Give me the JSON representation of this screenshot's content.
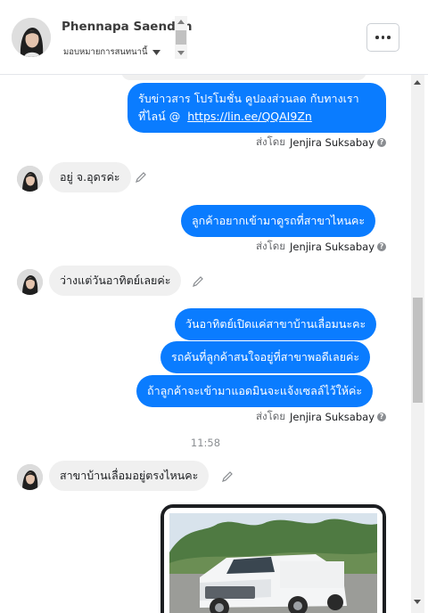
{
  "header": {
    "contact_name": "Phennapa Saendan",
    "assign_label": "มอบหมายการสนทนานี้",
    "more_label": "..."
  },
  "messages": [
    {
      "type": "outgoing",
      "lines": [
        "รับข่าวสาร  โปรโมชั่น คูปองส่วนลด กับทางเรา",
        "ที่ไลน์ @"
      ],
      "link": "https://lin.ee/QQAI9Zn"
    },
    {
      "type": "sent_by",
      "prefix": "ส่งโดย",
      "agent": "Jenjira Suksabay"
    },
    {
      "type": "incoming",
      "text": "อยู่ จ.อุดรค่ะ"
    },
    {
      "type": "outgoing",
      "text": "ลูกค้าอยากเข้ามาดูรถที่สาขาไหนคะ"
    },
    {
      "type": "sent_by",
      "prefix": "ส่งโดย",
      "agent": "Jenjira Suksabay"
    },
    {
      "type": "incoming",
      "text": "ว่างแต่วันอาทิตย์เลยค่ะ"
    },
    {
      "type": "outgoing",
      "text": "วันอาทิตย์เปิดแค่สาขาบ้านเลื่อมนะคะ"
    },
    {
      "type": "outgoing",
      "text": "รถคันที่ลูกค้าสนใจอยู่ที่สาขาพอดีเลยค่ะ"
    },
    {
      "type": "outgoing",
      "text": "ถ้าลูกค้าจะเข้ามาแอดมินจะแจ้งเซลล์ไว้ให้ค่ะ"
    },
    {
      "type": "sent_by",
      "prefix": "ส่งโดย",
      "agent": "Jenjira Suksabay"
    },
    {
      "type": "timestamp",
      "text": "11:58"
    },
    {
      "type": "incoming",
      "text": "สาขาบ้านเลื่อมอยู่ตรงไหนคะ"
    }
  ],
  "colors": {
    "outgoing_bubble": "#0a7cff",
    "incoming_bubble": "#f0f0f0",
    "meta_text": "#65676b"
  },
  "icons": {
    "more": "more-dots-icon",
    "edit": "pencil-icon",
    "help": "question-icon",
    "dropdown": "caret-down-icon"
  }
}
